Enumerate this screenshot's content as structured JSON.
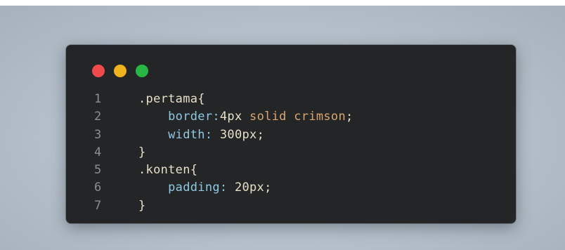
{
  "window": {
    "controls": [
      {
        "name": "close-dot",
        "color": "#f04a4d"
      },
      {
        "name": "minimize-dot",
        "color": "#f0b21d"
      },
      {
        "name": "zoom-dot",
        "color": "#28b744"
      }
    ]
  },
  "colors": {
    "line_number": "#8a8f96",
    "selector": "#e6e0c8",
    "property": "#8ec9e2",
    "value": "#e6e0c8",
    "keyword_value": "#d9a66e",
    "punctuation": "#e6e0c8"
  },
  "code": {
    "lines": [
      {
        "num": "1",
        "tokens": [
          {
            "text": ".pertama{",
            "kind": "selector"
          }
        ]
      },
      {
        "num": "2",
        "tokens": [
          {
            "text": "    ",
            "kind": "punctuation"
          },
          {
            "text": "border:",
            "kind": "property"
          },
          {
            "text": "4px",
            "kind": "value"
          },
          {
            "text": " solid crimson",
            "kind": "keyword_value"
          },
          {
            "text": ";",
            "kind": "punctuation"
          }
        ]
      },
      {
        "num": "3",
        "tokens": [
          {
            "text": "    ",
            "kind": "punctuation"
          },
          {
            "text": "width:",
            "kind": "property"
          },
          {
            "text": " 300px",
            "kind": "value"
          },
          {
            "text": ";",
            "kind": "punctuation"
          }
        ]
      },
      {
        "num": "4",
        "tokens": [
          {
            "text": "}",
            "kind": "punctuation"
          }
        ]
      },
      {
        "num": "5",
        "tokens": [
          {
            "text": ".konten{",
            "kind": "selector"
          }
        ]
      },
      {
        "num": "6",
        "tokens": [
          {
            "text": "    ",
            "kind": "punctuation"
          },
          {
            "text": "padding:",
            "kind": "property"
          },
          {
            "text": " 20px",
            "kind": "value"
          },
          {
            "text": ";",
            "kind": "punctuation"
          }
        ]
      },
      {
        "num": "7",
        "tokens": [
          {
            "text": "}",
            "kind": "punctuation"
          }
        ]
      }
    ]
  }
}
